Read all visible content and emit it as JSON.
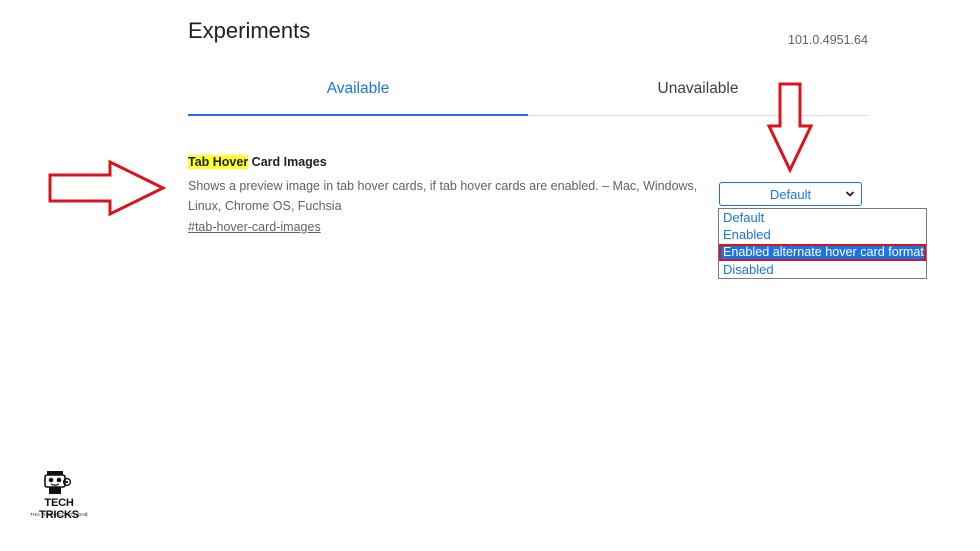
{
  "page": {
    "title": "Experiments",
    "version": "101.0.4951.64"
  },
  "tabs": [
    {
      "label": "Available",
      "active": true
    },
    {
      "label": "Unavailable",
      "active": false
    }
  ],
  "experiment": {
    "title_highlight": "Tab Hover",
    "title_rest": " Card Images",
    "description": "Shows a preview image in tab hover cards, if tab hover cards are enabled. – Mac, Windows, Linux, Chrome OS, Fuchsia",
    "link": "#tab-hover-card-images",
    "select_value": "Default",
    "options": [
      "Default",
      "Enabled",
      "Enabled alternate hover card format",
      "Disabled"
    ],
    "selected_option_index": 2
  },
  "logo": {
    "name": "TECH TRICKS",
    "tagline": "THỦ THUẬT CÔNG NGHỆ"
  },
  "colors": {
    "accent": "#1a73e8",
    "highlight": "#ffff2a",
    "annotation_red": "#d9141c"
  }
}
